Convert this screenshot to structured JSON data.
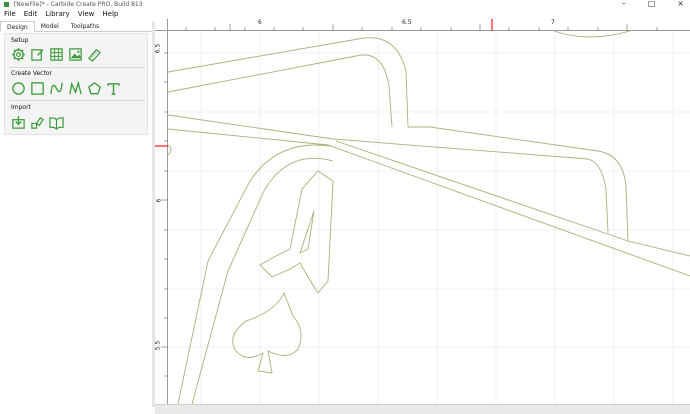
{
  "window": {
    "title": "[NewFile]* - Carbide Create PRO, Build 813"
  },
  "menu": [
    "File",
    "Edit",
    "Library",
    "View",
    "Help"
  ],
  "tabs": [
    {
      "label": "Design",
      "active": true
    },
    {
      "label": "Model",
      "active": false
    },
    {
      "label": "Toolpaths",
      "active": false
    }
  ],
  "sections": {
    "setup": {
      "label": "Setup",
      "tools": [
        "job-setup-icon",
        "edit-icon",
        "grid-icon",
        "image-icon",
        "measure-icon"
      ]
    },
    "create_vector": {
      "label": "Create Vector",
      "tools": [
        "circle-icon",
        "rectangle-icon",
        "curve-icon",
        "polyline-icon",
        "polygon-icon",
        "text-icon"
      ]
    },
    "import": {
      "label": "Import",
      "tools": [
        "import-icon",
        "import-vector-icon",
        "library-icon"
      ]
    }
  },
  "ruler": {
    "top": [
      "6",
      "6.5",
      "7"
    ],
    "left": [
      "6.5",
      "6",
      "5.5"
    ]
  },
  "colors": {
    "accent": "#3a9a3a",
    "vector": "#a8b27a",
    "marker": "#ff2a2a",
    "grid": "#e4e4e4"
  }
}
